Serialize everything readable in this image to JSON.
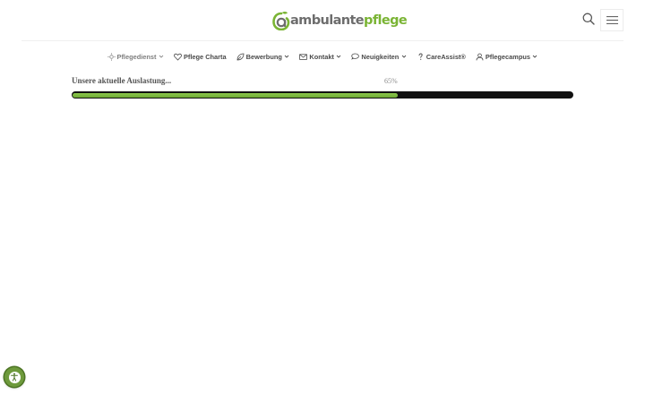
{
  "header": {
    "logo": {
      "text_gray": "ambulante",
      "text_green": "pflege"
    },
    "search_icon": "search-icon",
    "menu_icon": "hamburger-menu-icon"
  },
  "nav": {
    "items": [
      {
        "label": "Pflegedienst",
        "icon": "sun-icon",
        "has_dropdown": true,
        "active": true
      },
      {
        "label": "Pflege Charta",
        "icon": "heart-icon",
        "has_dropdown": false,
        "active": false
      },
      {
        "label": "Bewerbung",
        "icon": "leaf-icon",
        "has_dropdown": true,
        "active": false
      },
      {
        "label": "Kontakt",
        "icon": "envelope-icon",
        "has_dropdown": true,
        "active": false
      },
      {
        "label": "Neuigkeiten",
        "icon": "chat-bubble-icon",
        "has_dropdown": true,
        "active": false
      },
      {
        "label": "CareAssist®",
        "icon": "question-mark-icon",
        "has_dropdown": false,
        "active": false
      },
      {
        "label": "Pflegecampus",
        "icon": "user-icon",
        "has_dropdown": true,
        "active": false
      }
    ]
  },
  "progress": {
    "label": "Unsere aktuelle Auslastung...",
    "value_text": "65%",
    "value": 65
  },
  "accessibility": {
    "icon": "accessibility-icon"
  },
  "colors": {
    "brand_green": "#7ab434",
    "progress_track": "#111111",
    "accessibility_bg": "#6e9a3c"
  }
}
